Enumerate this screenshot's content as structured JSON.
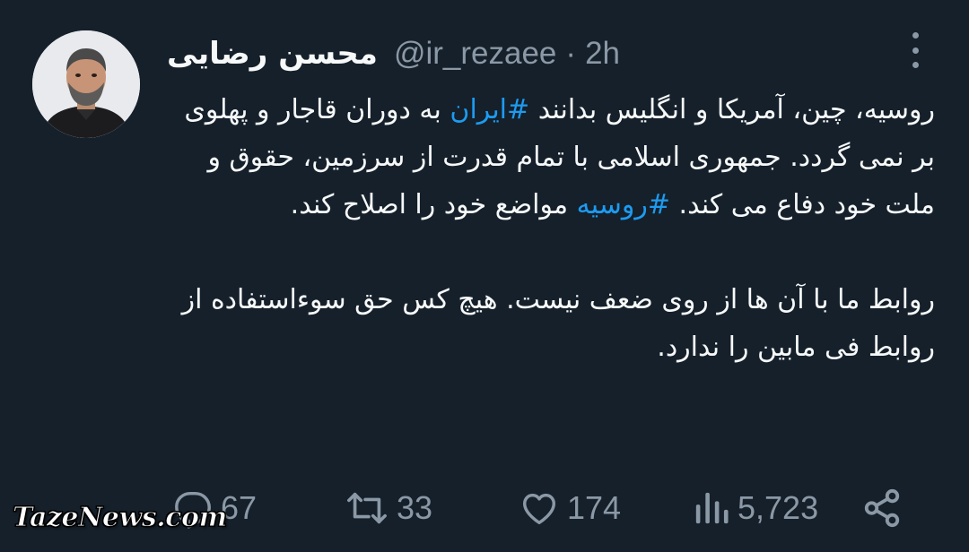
{
  "tweet": {
    "author": {
      "display_name": "محسن رضایی",
      "handle": "@ir_rezaee",
      "separator": "·",
      "time": "2h",
      "avatar_icon": "profile-photo"
    },
    "body": {
      "p1_line1_pre": "روسیه، چین، آمریکا و انگلیس بدانند ",
      "p1_hashtag1": "#ایران",
      "p1_line1_post": " به دوران قاجار و پهلوی بر نمی گردد. جمهوری اسلامی با تمام قدرت از سرزمین، حقوق و ملت خود دفاع می کند. ",
      "p1_hashtag2": "#روسیه",
      "p1_tail": " مواضع خود را اصلاح کند.",
      "p2": "روابط ما با آن ها از روی ضعف نیست. هیچ کس حق سوءاستفاده از روابط فی مابین را ندارد."
    },
    "actions": {
      "replies": "67",
      "retweets": "33",
      "likes": "174",
      "views": "5,723"
    },
    "colors": {
      "background": "#15202b",
      "text": "#f7f9f9",
      "muted": "#8b98a5",
      "link": "#1d9bf0"
    }
  },
  "watermark": "TazeNews.com"
}
